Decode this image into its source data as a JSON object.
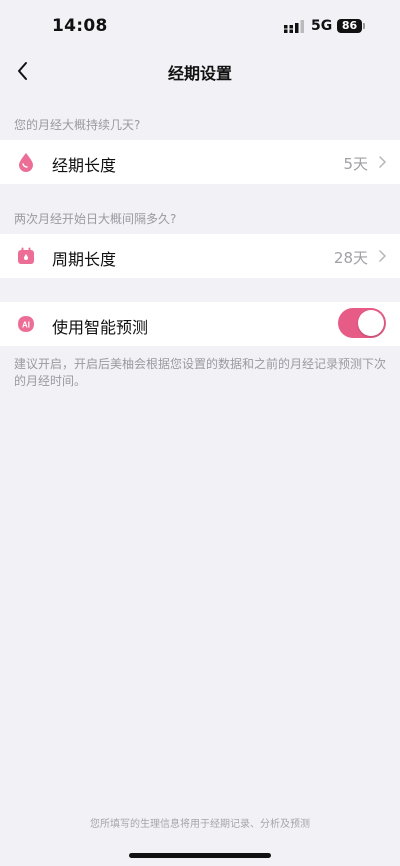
{
  "status_bar": {
    "time": "14:08",
    "network": "5G",
    "battery": "86"
  },
  "nav": {
    "title": "经期设置",
    "back_icon": "chevron-left-icon"
  },
  "sections": {
    "period": {
      "hint": "您的月经大概持续几天?",
      "label": "经期长度",
      "value": "5天",
      "icon": "drop-icon"
    },
    "cycle": {
      "hint": "两次月经开始日大概间隔多久?",
      "label": "周期长度",
      "value": "28天",
      "icon": "calendar-icon"
    },
    "ai": {
      "label": "使用智能预测",
      "icon_text": "AI",
      "enabled": true,
      "description": "建议开启，开启后美柚会根据您设置的数据和之前的月经记录预测下次的月经时间。"
    }
  },
  "footer": {
    "note": "您所填写的生理信息将用于经期记录、分析及预测"
  },
  "colors": {
    "accent": "#e75c86",
    "background": "#f2f1f6",
    "hint_text": "#9a9a9f"
  }
}
